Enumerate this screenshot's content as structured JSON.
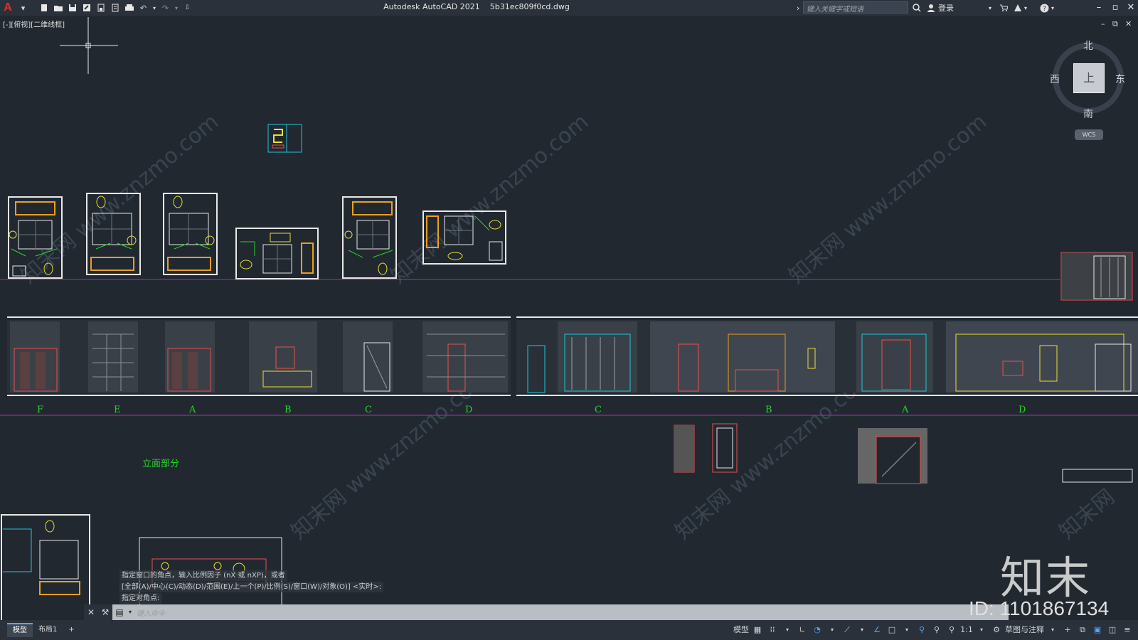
{
  "app": {
    "title": "Autodesk AutoCAD 2021",
    "filename": "5b31ec809f0cd.dwg",
    "logo": "A"
  },
  "quick_access": {
    "items": [
      "new-icon",
      "open-icon",
      "save-icon",
      "save-as-icon",
      "publish-icon",
      "plot-icon",
      "print-icon",
      "undo-icon",
      "redo-icon",
      "customize-icon"
    ]
  },
  "search": {
    "placeholder": "键入关键字或短语"
  },
  "account": {
    "login_label": "登录"
  },
  "viewport": {
    "label": "[-][俯视][二维线框]"
  },
  "viewcube": {
    "top_label": "上",
    "north": "北",
    "south": "南",
    "east": "东",
    "west": "西",
    "wcs": "WCS"
  },
  "drawing": {
    "elevation_letters_left": [
      "F",
      "E",
      "A",
      "B",
      "C",
      "D"
    ],
    "elevation_letters_right": [
      "C",
      "B",
      "A",
      "D"
    ],
    "section_title": "立面部分",
    "accent_green": "#24d824",
    "guide_magenta": "#c020c0"
  },
  "command": {
    "history": [
      "指定窗口的角点，输入比例因子 (nX 或 nXP)，或者",
      "[全部(A)/中心(C)/动态(D)/范围(E)/上一个(P)/比例(S)/窗口(W)/对象(O)] <实时>:",
      "指定对角点:"
    ],
    "placeholder": "键入命令"
  },
  "watermark": {
    "brand": "知末",
    "id": "ID: 1101867134",
    "diagonal_text": "知末网 www.znzmo.com"
  },
  "statusbar": {
    "tabs": [
      "模型",
      "布局1"
    ],
    "add_tab": "+",
    "model_label": "模型",
    "scale": "1:1",
    "workspace": "草图与注释"
  }
}
